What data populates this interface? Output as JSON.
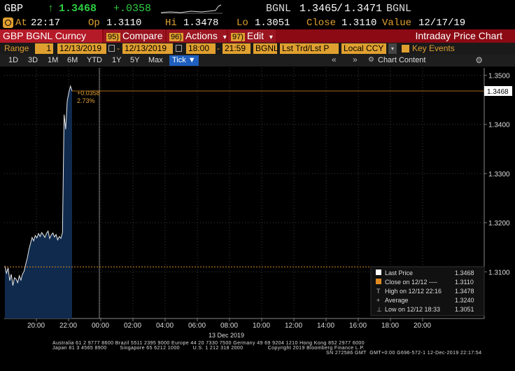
{
  "ticker": {
    "symbol": "GBP",
    "arrow": "↑",
    "last": "1.3468",
    "change": "+.0358",
    "source": "BGNL",
    "bid": "1.3465",
    "sep": "/",
    "ask": "1.3471",
    "source2": "BGNL"
  },
  "quote": {
    "at_label": "At",
    "at": "22:17",
    "op_label": "Op",
    "op": "1.3110",
    "hi_label": "Hi",
    "hi": "1.3478",
    "lo_label": "Lo",
    "lo": "1.3051",
    "close_label": "Close",
    "close": "1.3110",
    "value_label": "Value",
    "value": "12/17/19"
  },
  "toolbar": {
    "security": "GBP BGNL Curncy",
    "compare_num": "95)",
    "compare": "Compare",
    "actions_num": "96)",
    "actions": "Actions",
    "edit_num": "97)",
    "edit": "Edit",
    "title": "Intraday Price Chart",
    "dropdown": "▾"
  },
  "range": {
    "label": "Range",
    "count": "1",
    "start": "12/13/2019",
    "dash": "-",
    "end": "12/13/2019",
    "t_start": "18:00",
    "t_end": "21:59",
    "source": "BGNL",
    "field": "Lst Trd/Lst P",
    "ccy": "Local CCY",
    "events": "Key Events"
  },
  "periods": {
    "items": [
      "1D",
      "3D",
      "1M",
      "6M",
      "YTD",
      "1Y",
      "5Y",
      "Max"
    ],
    "tick": "Tick ▼",
    "chart_content": "Chart Content"
  },
  "chart_data": {
    "type": "area",
    "ylim": [
      1.3005,
      1.3515
    ],
    "yticks": [
      "1.3500",
      "1.3400",
      "1.3300",
      "1.3200",
      "1.3100"
    ],
    "ytick_values": [
      1.35,
      1.34,
      1.33,
      1.32,
      1.31
    ],
    "xticks": [
      "20:00",
      "22:00",
      "00:00",
      "02:00",
      "04:00",
      "06:00",
      "08:00",
      "10:00",
      "12:00",
      "14:00",
      "16:00",
      "18:00",
      "20:00"
    ],
    "xlabel": "13 Dec 2019",
    "last_price_label": "1.3468",
    "last_price": 1.3468,
    "prev_close": 1.311,
    "annotation_change": "+0.0358",
    "annotation_pct": "2.73%",
    "series": [
      {
        "values": [
          1.3112,
          1.3097,
          1.3108,
          1.3082,
          1.3095,
          1.3072,
          1.3088,
          1.3085,
          1.3078,
          1.3092,
          1.3083,
          1.3095,
          1.3101,
          1.3115,
          1.3128,
          1.3145,
          1.3158,
          1.317,
          1.3163,
          1.3174,
          1.3169,
          1.3178,
          1.3172,
          1.318,
          1.3175,
          1.317,
          1.3178,
          1.3183,
          1.3168,
          1.3175,
          1.3179,
          1.3171,
          1.3176,
          1.3165,
          1.3172,
          1.3168,
          1.318,
          1.342,
          1.339,
          1.3448,
          1.3465,
          1.3478,
          1.3468
        ]
      }
    ],
    "legend": [
      {
        "marker": "white",
        "label": "Last Price",
        "value": "1.3468"
      },
      {
        "marker": "orange",
        "label": "Close on 12/12 ----",
        "value": "1.3110"
      },
      {
        "marker": "T",
        "label": "High on 12/12 22:16",
        "value": "1.3478"
      },
      {
        "marker": "+",
        "label": "Average",
        "value": "1.3240"
      },
      {
        "marker": "⊥",
        "label": "Low on 12/12 18:33",
        "value": "1.3051"
      }
    ]
  },
  "footer": {
    "line1": "Australia 61 2 9777 8600 Brazil 5511 2395 9000 Europe 44 20 7330 7500 Germany 49 69 9204 1210 Hong Kong 852 2977 6000",
    "line2": "Japan 81 3 4565 8900        Singapore 65 6212 1000        U.S. 1 212 318 2000               Copyright 2019 Bloomberg Finance L.P.",
    "line3": "SN 272586 GMT  GMT+0:00 G696-572-1 12-Dec-2019 22:17:54"
  }
}
